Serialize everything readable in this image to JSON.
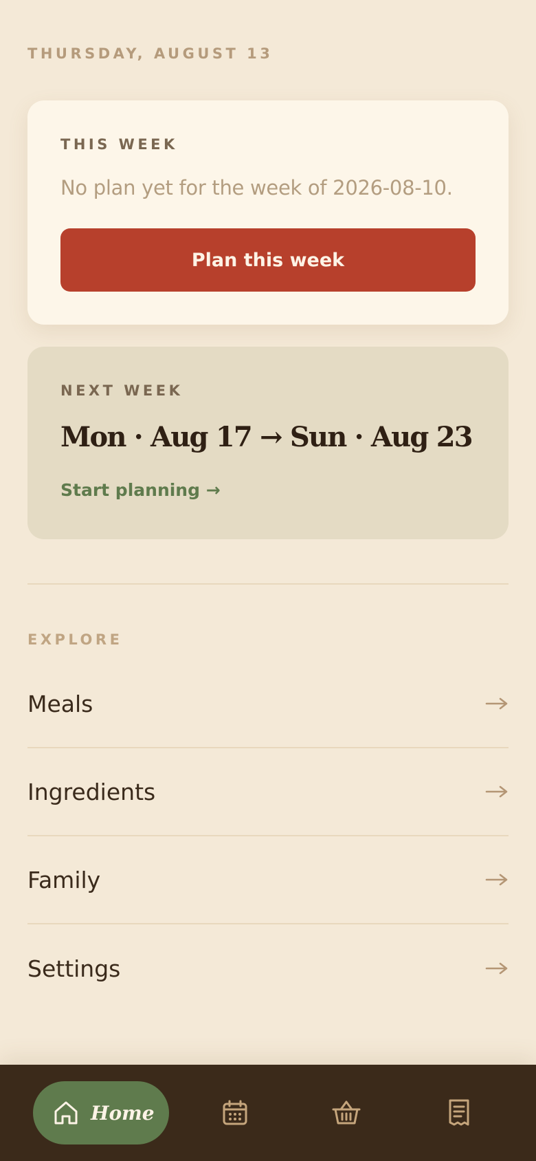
{
  "header": {
    "date": "THURSDAY, AUGUST 13"
  },
  "this_week": {
    "eyebrow": "THIS WEEK",
    "message": "No plan yet for the week of 2026-08-10.",
    "button_label": "Plan this week"
  },
  "next_week": {
    "eyebrow": "NEXT WEEK",
    "range": "Mon · Aug 17 → Sun · Aug 23",
    "link_label": "Start planning →"
  },
  "explore": {
    "label": "EXPLORE",
    "items": [
      {
        "label": "Meals"
      },
      {
        "label": "Ingredients"
      },
      {
        "label": "Family"
      },
      {
        "label": "Settings"
      }
    ]
  },
  "bottom_nav": {
    "home_label": "Home",
    "icons": [
      "home-icon",
      "calendar-icon",
      "basket-icon",
      "receipt-icon"
    ]
  },
  "colors": {
    "background": "#f4e9d7",
    "primary_button": "#b7402c",
    "accent_green": "#5f7b4d",
    "nav_background": "#3b2a1a"
  }
}
